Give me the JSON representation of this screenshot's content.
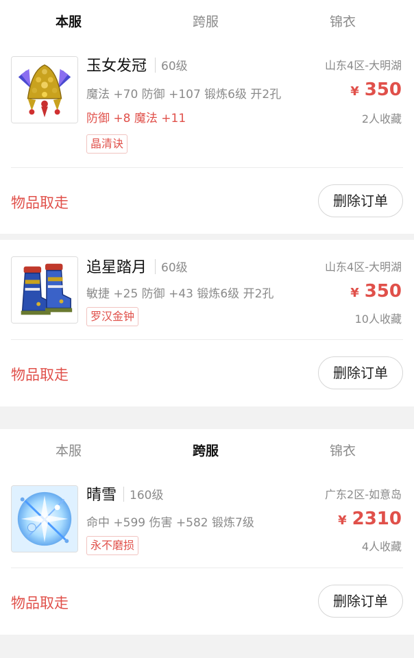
{
  "tabs": [
    "本服",
    "跨服",
    "锦衣"
  ],
  "orders": [
    {
      "active_tab": 0,
      "name": "玉女发冠",
      "level": "60级",
      "attrs": [
        "魔法 +70 防御 +107 锻炼6级 开2孔"
      ],
      "extra_attrs": "防御 +8 魔法 +11",
      "tag": "晶清诀",
      "server": "山东4区-大明湖",
      "currency": "¥",
      "price": "350",
      "favorites": "2人收藏",
      "status": "物品取走",
      "action": "删除订单",
      "icon": "crown-icon"
    },
    {
      "name": "追星踏月",
      "level": "60级",
      "attrs": [
        "敏捷 +25 防御 +43 锻炼6级 开2孔"
      ],
      "tag": "罗汉金钟",
      "server": "山东4区-大明湖",
      "currency": "¥",
      "price": "350",
      "favorites": "10人收藏",
      "status": "物品取走",
      "action": "删除订单",
      "icon": "boots-icon"
    },
    {
      "active_tab": 1,
      "name": "晴雪",
      "level": "160级",
      "attrs": [
        "命中 +599 伤害 +582 锻炼7级"
      ],
      "tag": "永不磨损",
      "server": "广东2区-如意岛",
      "currency": "¥",
      "price": "2310",
      "favorites": "4人收藏",
      "status": "物品取走",
      "action": "删除订单",
      "icon": "ice-weapon-icon"
    }
  ],
  "colors": {
    "accent": "#e0504a",
    "muted": "#8a8a8a",
    "background": "#f2f2f2"
  }
}
